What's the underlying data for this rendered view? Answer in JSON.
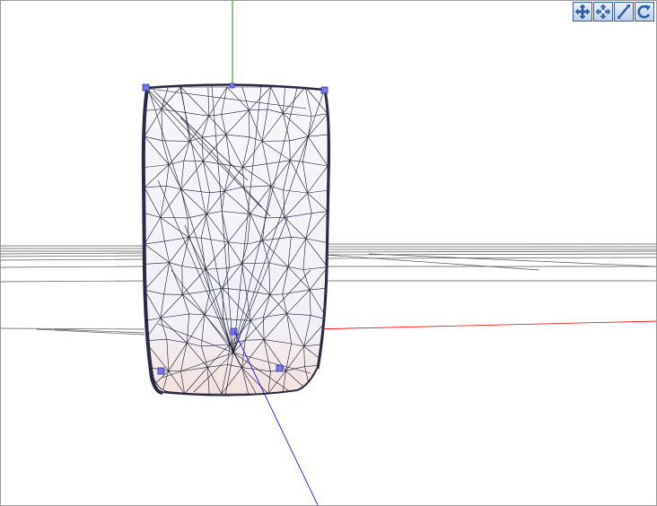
{
  "viewport": {
    "background": "#ffffff",
    "axes": {
      "x_color": "#ff0000",
      "y_color": "#008000",
      "z_color": "#0000ff"
    },
    "mesh": {
      "render_mode": "wireframe",
      "edge_color": "#1a1a33",
      "fill_color": "#f4f4f8",
      "bottom_tint": "#f3e1dc",
      "handle_color": "#6666dd",
      "handle_count": 6
    }
  },
  "toolbar": {
    "tools": [
      {
        "id": "pan",
        "icon": "pan-arrows-icon"
      },
      {
        "id": "move",
        "icon": "move-arrows-icon"
      },
      {
        "id": "zoom",
        "icon": "zoom-icon"
      },
      {
        "id": "rotate",
        "icon": "rotate-icon"
      }
    ]
  }
}
